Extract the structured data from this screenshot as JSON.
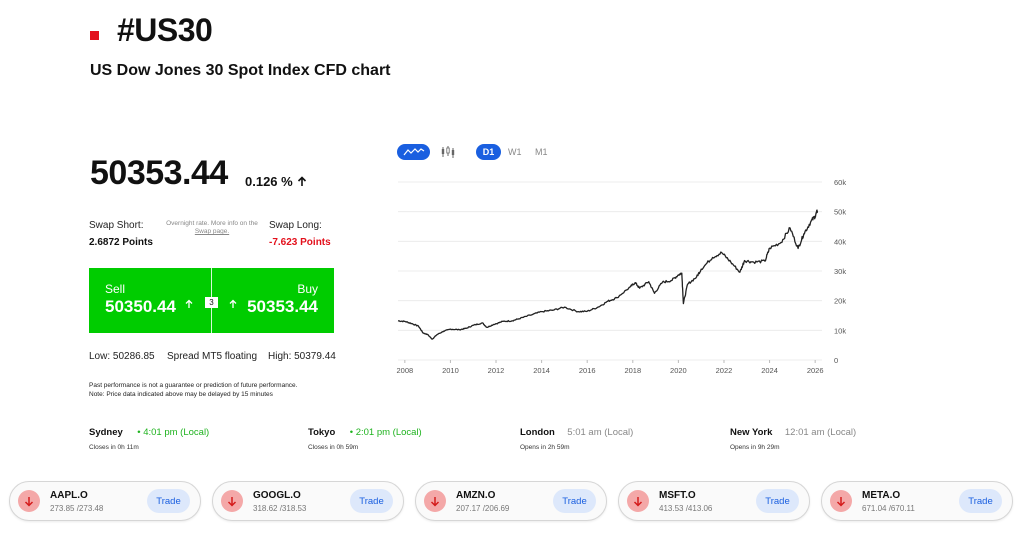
{
  "header": {
    "symbol": "#US30",
    "subtitle": "US Dow Jones 30 Spot Index CFD chart"
  },
  "quote": {
    "price": "50353.44",
    "change": "0.126 %",
    "change_direction": "up"
  },
  "swap": {
    "short_label": "Swap Short:",
    "short_value": "2.6872 Points",
    "note_prefix": "Overnight rate. More info on the",
    "note_link": "Swap page.",
    "long_label": "Swap Long:",
    "long_value": "-7.623 Points",
    "long_color": "#e3101c"
  },
  "trade": {
    "sell_label": "Sell",
    "sell_price": "50350.44",
    "buy_label": "Buy",
    "buy_price": "50353.44",
    "spread": "3",
    "color": "#00cc00"
  },
  "range": {
    "low": "Low: 50286.85",
    "spread_type": "Spread MT5 floating",
    "high": "High: 50379.44"
  },
  "disclaimer": {
    "line1": "Past performance is not a guarantee or prediction of future performance.",
    "line2": "Note: Price data indicated above may be delayed by 15 minutes"
  },
  "sessions": [
    {
      "city": "Sydney",
      "time": "• 4:01 pm (Local)",
      "status": "Closes in 0h 11m",
      "open": true
    },
    {
      "city": "Tokyo",
      "time": "• 2:01 pm (Local)",
      "status": "Closes in 0h 59m",
      "open": true
    },
    {
      "city": "London",
      "time": "5:01 am (Local)",
      "status": "Opens in 2h 59m",
      "open": false
    },
    {
      "city": "New York",
      "time": "12:01 am (Local)",
      "status": "Opens in 9h 29m",
      "open": false
    }
  ],
  "chart_controls": {
    "chart_type_line_icon": "line-chart-icon",
    "chart_type_candle_icon": "candlestick-icon",
    "timeframes": [
      "D1",
      "W1",
      "M1"
    ],
    "active_timeframe": "D1",
    "accent": "#1a5fe0"
  },
  "tickers": [
    {
      "symbol": "AAPL.O",
      "prices": "273.85 /273.48",
      "trade_label": "Trade",
      "icon": "arrow-down-icon"
    },
    {
      "symbol": "GOOGL.O",
      "prices": "318.62 /318.53",
      "trade_label": "Trade",
      "icon": "arrow-down-icon"
    },
    {
      "symbol": "AMZN.O",
      "prices": "207.17 /206.69",
      "trade_label": "Trade",
      "icon": "arrow-down-icon"
    },
    {
      "symbol": "MSFT.O",
      "prices": "413.53 /413.06",
      "trade_label": "Trade",
      "icon": "arrow-down-icon"
    },
    {
      "symbol": "META.O",
      "prices": "671.04 /670.11",
      "trade_label": "Trade",
      "icon": "arrow-down-icon"
    }
  ],
  "chart_data": {
    "type": "line",
    "x_ticks": [
      "2008",
      "2010",
      "2012",
      "2014",
      "2016",
      "2018",
      "2020",
      "2022",
      "2024",
      "2026"
    ],
    "y_ticks": [
      "0",
      "10k",
      "20k",
      "30k",
      "40k",
      "50k",
      "60k"
    ],
    "xlim": [
      2007.7,
      2026.3
    ],
    "ylim": [
      0,
      60000
    ],
    "grid": true,
    "series": [
      {
        "color": "#222222",
        "points": [
          [
            2007.7,
            13200
          ],
          [
            2008.0,
            13000
          ],
          [
            2008.3,
            12300
          ],
          [
            2008.6,
            11400
          ],
          [
            2008.8,
            9100
          ],
          [
            2009.0,
            8600
          ],
          [
            2009.2,
            7000
          ],
          [
            2009.4,
            8500
          ],
          [
            2009.7,
            9700
          ],
          [
            2010.0,
            10400
          ],
          [
            2010.4,
            10200
          ],
          [
            2010.7,
            10700
          ],
          [
            2011.0,
            11700
          ],
          [
            2011.4,
            12500
          ],
          [
            2011.6,
            11000
          ],
          [
            2011.9,
            12000
          ],
          [
            2012.3,
            13000
          ],
          [
            2012.7,
            13200
          ],
          [
            2013.0,
            13900
          ],
          [
            2013.5,
            15100
          ],
          [
            2014.0,
            16300
          ],
          [
            2014.5,
            16800
          ],
          [
            2015.0,
            17800
          ],
          [
            2015.6,
            16300
          ],
          [
            2016.0,
            16400
          ],
          [
            2016.5,
            17900
          ],
          [
            2016.9,
            19800
          ],
          [
            2017.3,
            21000
          ],
          [
            2017.9,
            24700
          ],
          [
            2018.1,
            26100
          ],
          [
            2018.3,
            24200
          ],
          [
            2018.7,
            26400
          ],
          [
            2018.95,
            22500
          ],
          [
            2019.3,
            26200
          ],
          [
            2019.7,
            26800
          ],
          [
            2020.0,
            28700
          ],
          [
            2020.15,
            29300
          ],
          [
            2020.22,
            19000
          ],
          [
            2020.4,
            25500
          ],
          [
            2020.8,
            28000
          ],
          [
            2021.0,
            30600
          ],
          [
            2021.5,
            34600
          ],
          [
            2021.9,
            36200
          ],
          [
            2022.3,
            33000
          ],
          [
            2022.7,
            29600
          ],
          [
            2022.9,
            33500
          ],
          [
            2023.3,
            33000
          ],
          [
            2023.8,
            33300
          ],
          [
            2024.0,
            37700
          ],
          [
            2024.5,
            39600
          ],
          [
            2024.9,
            44500
          ],
          [
            2025.25,
            37600
          ],
          [
            2025.5,
            42500
          ],
          [
            2025.8,
            46500
          ],
          [
            2026.0,
            48500
          ],
          [
            2026.1,
            50300
          ]
        ]
      }
    ]
  }
}
